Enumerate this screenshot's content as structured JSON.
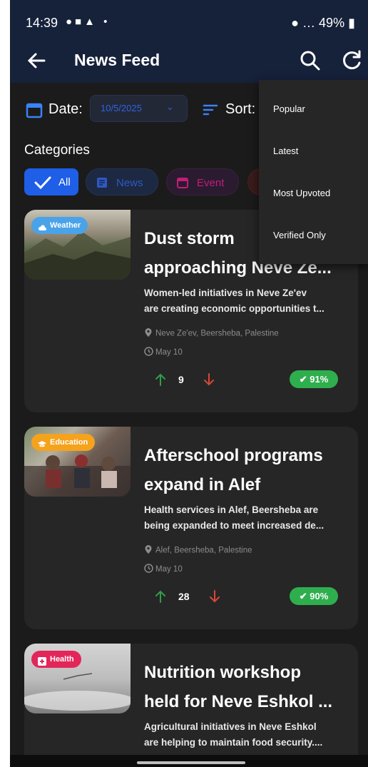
{
  "status": {
    "time": "14:39",
    "battery": "49%"
  },
  "appbar": {
    "title": "News Feed"
  },
  "filter": {
    "date_label": "Date:",
    "date_value": "10/5/2025",
    "sort_label": "Sort:"
  },
  "categories": {
    "label": "Categories",
    "chips": [
      {
        "label": "All",
        "selected": true,
        "color": "#1f5ee6"
      },
      {
        "label": "News",
        "color": "#2e59c5"
      },
      {
        "label": "Event",
        "color": "#c21d7a"
      }
    ]
  },
  "sort_menu": [
    "Popular",
    "Latest",
    "Most Upvoted",
    "Verified Only"
  ],
  "articles": [
    {
      "category": "Weather",
      "category_color": "#4aa3e8",
      "title_lines": [
        "Dust storm",
        "approaching Neve Ze..."
      ],
      "desc_lines": [
        "Women-led initiatives in Neve Ze'ev",
        "are creating economic opportunities t..."
      ],
      "location": "Neve Ze'ev, Beersheba, Palestine",
      "date": "May 10",
      "upvotes": "9",
      "verified": "91%"
    },
    {
      "category": "Education",
      "category_color": "#f5a21c",
      "title_lines": [
        "Afterschool programs",
        "expand in Alef"
      ],
      "desc_lines": [
        "Health services in Alef, Beersheba are",
        "being expanded to meet increased de..."
      ],
      "location": "Alef, Beersheba, Palestine",
      "date": "May 10",
      "upvotes": "28",
      "verified": "90%"
    },
    {
      "category": "Health",
      "category_color": "#e3265a",
      "title_lines": [
        "Nutrition workshop",
        "held for Neve Eshkol ..."
      ],
      "desc_lines": [
        "Agricultural initiatives in Neve Eshkol",
        "are helping to maintain food security...."
      ]
    }
  ]
}
